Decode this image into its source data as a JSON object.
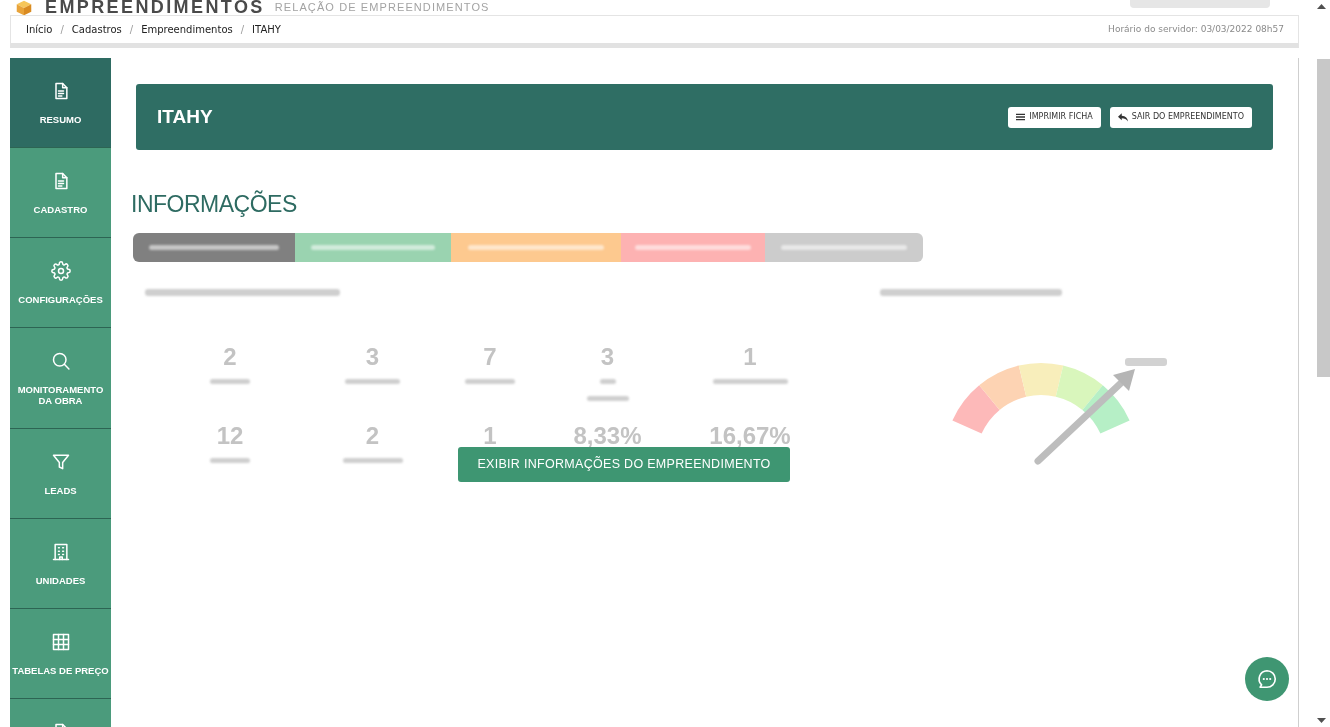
{
  "header": {
    "title": "EMPREENDIMENTOS",
    "subtitle": "RELAÇÃO DE EMPREENDIMENTOS"
  },
  "breadcrumb": {
    "items": [
      {
        "label": "Início"
      },
      {
        "separator": "/",
        "label": "Cadastros"
      },
      {
        "separator": "/",
        "label": "Empreendimentos"
      },
      {
        "separator": "/",
        "label": "ITAHY"
      }
    ],
    "server_time": "Horário do servidor: 03/03/2022 08h57"
  },
  "sidebar": {
    "items": [
      {
        "label": "RESUMO",
        "selected": true
      },
      {
        "label": "CADASTRO",
        "selected": false
      },
      {
        "label": "CONFIGURAÇÕES",
        "selected": false
      },
      {
        "label": "MONITORAMENTO DA OBRA",
        "selected": false
      },
      {
        "label": "LEADS",
        "selected": false
      },
      {
        "label": "UNIDADES",
        "selected": false
      },
      {
        "label": "TABELAS DE PREÇO",
        "selected": false
      },
      {
        "selected": false
      }
    ]
  },
  "project": {
    "title": "ITAHY",
    "buttons": [
      "IMPRIMIR FICHA",
      "SAIR DO EMPREENDIMENTO"
    ]
  },
  "section_title": "INFORMAÇÕES",
  "status_legend": [
    {
      "color": "#808080"
    },
    {
      "color": "#9ad3b0"
    },
    {
      "color": "#fdc98f"
    },
    {
      "color": "#fdb2b2"
    },
    {
      "color": "#cccccc"
    }
  ],
  "stats": [
    "2",
    "3",
    "7",
    "3",
    "1",
    "12",
    "2",
    "1",
    "8,33%",
    "16,67%"
  ],
  "show_button": "EXIBIR INFORMAÇÕES DO EMPREENDIMENTO"
}
